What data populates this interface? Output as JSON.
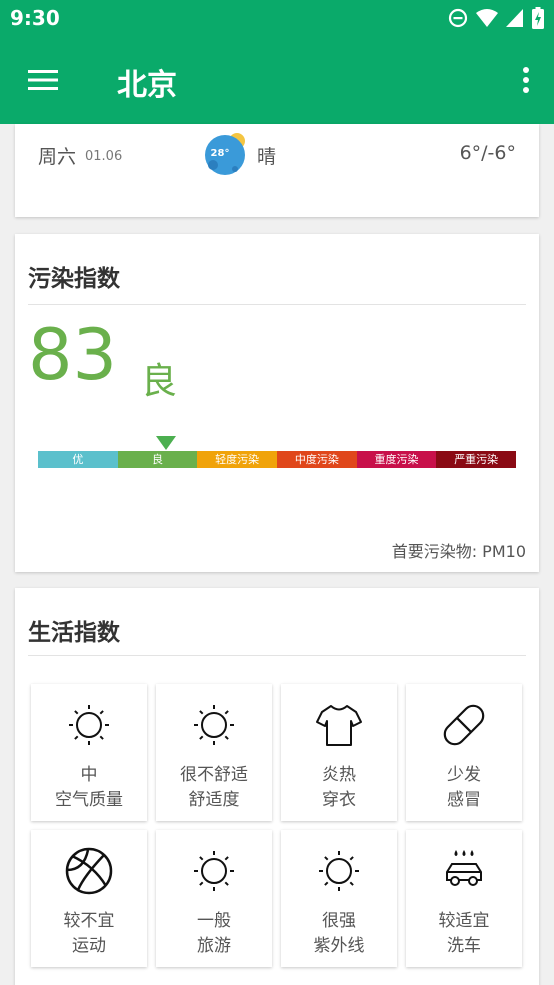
{
  "status_bar": {
    "time": "9:30",
    "icons": [
      "do-not-disturb-icon",
      "wifi-icon",
      "signal-icon",
      "battery-charging-icon"
    ]
  },
  "app_bar": {
    "title": "北京",
    "menu_icon": "hamburger-menu-icon",
    "more_icon": "more-vert-icon"
  },
  "forecast": {
    "day": "周六",
    "date": "01.06",
    "weather_icon_badge": "28°",
    "condition": "晴",
    "temp_range": "6°/-6°"
  },
  "pollution": {
    "title": "污染指数",
    "aqi": "83",
    "grade": "良",
    "pointer_fraction": 0.268,
    "scale": [
      {
        "label": "优",
        "color": "#5bc0cc"
      },
      {
        "label": "良",
        "color": "#6ab04c"
      },
      {
        "label": "轻度污染",
        "color": "#f0a30a"
      },
      {
        "label": "中度污染",
        "color": "#e0471b"
      },
      {
        "label": "重度污染",
        "color": "#c8104a"
      },
      {
        "label": "严重污染",
        "color": "#8a0a14"
      }
    ],
    "primary_pollutant": "首要污染物: PM10"
  },
  "life": {
    "title": "生活指数",
    "items": [
      {
        "icon": "sun-icon",
        "line1": "中",
        "line2": "空气质量"
      },
      {
        "icon": "sun-icon",
        "line1": "很不舒适",
        "line2": "舒适度"
      },
      {
        "icon": "tshirt-icon",
        "line1": "炎热",
        "line2": "穿衣"
      },
      {
        "icon": "pill-icon",
        "line1": "少发",
        "line2": "感冒"
      },
      {
        "icon": "basketball-icon",
        "line1": "较不宜",
        "line2": "运动"
      },
      {
        "icon": "sun-icon",
        "line1": "一般",
        "line2": "旅游"
      },
      {
        "icon": "sun-icon",
        "line1": "很强",
        "line2": "紫外线"
      },
      {
        "icon": "car-wash-icon",
        "line1": "较适宜",
        "line2": "洗车"
      }
    ]
  }
}
